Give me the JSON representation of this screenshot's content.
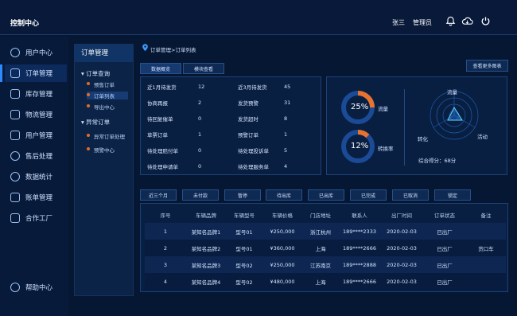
{
  "header": {
    "title": "控制中心",
    "user_name": "张三",
    "user_role": "管理员"
  },
  "sidebar": {
    "items": [
      {
        "label": "用户中心",
        "icon": "home-icon"
      },
      {
        "label": "订单管理",
        "icon": "orders-icon",
        "active": true
      },
      {
        "label": "库存管理",
        "icon": "box-icon"
      },
      {
        "label": "物流管理",
        "icon": "truck-icon"
      },
      {
        "label": "用户管理",
        "icon": "user-icon"
      },
      {
        "label": "售后处理",
        "icon": "service-icon"
      },
      {
        "label": "数据统计",
        "icon": "pie-icon"
      },
      {
        "label": "账单管理",
        "icon": "bill-icon"
      },
      {
        "label": "合作工厂",
        "icon": "factory-icon"
      }
    ],
    "help": "帮助中心"
  },
  "subnav": {
    "title": "订单管理",
    "groups": [
      {
        "label": "订单查询",
        "items": [
          "预售订单",
          "订单列表",
          "导出中心"
        ]
      },
      {
        "label": "异常订单",
        "items": [
          "异常订单处理",
          "预警中心"
        ]
      }
    ]
  },
  "breadcrumb": "订单管理>订单列表",
  "tabs": [
    "数据概览",
    "模块查看"
  ],
  "more_button": "查看更多图表",
  "stats": [
    [
      "近1月待发货",
      "12",
      "近3月待发货",
      "45"
    ],
    [
      "协商再报",
      "2",
      "发货预警",
      "31"
    ],
    [
      "待回复催单",
      "0",
      "发货超时",
      "8"
    ],
    [
      "草票订单",
      "1",
      "预警订单",
      "1"
    ],
    [
      "待处理赔付单",
      "0",
      "待处理投诉单",
      "5"
    ],
    [
      "待处理申请单",
      "0",
      "待处理服务单",
      "4"
    ]
  ],
  "donuts": [
    {
      "value": "25%",
      "label": "流量",
      "fraction": 0.25
    },
    {
      "value": "12%",
      "label": "转换率",
      "fraction": 0.12
    }
  ],
  "radar": {
    "labels": [
      "流量",
      "转化",
      "活动"
    ],
    "score": "综合得分：68分"
  },
  "filters": [
    "近三个月",
    "未付款",
    "暂停",
    "待出库",
    "已出库",
    "已完成",
    "已取消",
    "锁定"
  ],
  "table": {
    "headers": [
      "序号",
      "车辆品牌",
      "车辆型号",
      "车辆价格",
      "门店地址",
      "联系人",
      "出厂时间",
      "订单状态",
      "备注"
    ],
    "rows": [
      [
        "1",
        "某知名品牌1",
        "型号01",
        "¥250,000",
        "浙江杭州",
        "189****2333",
        "2020-02-03",
        "已出厂",
        ""
      ],
      [
        "2",
        "某知名品牌2",
        "型号01",
        "¥360,000",
        "上海",
        "189****2666",
        "2020-02-03",
        "已出厂",
        "货口车"
      ],
      [
        "3",
        "某知名品牌3",
        "型号02",
        "¥250,000",
        "江苏南京",
        "189****2888",
        "2020-02-03",
        "已出厂",
        ""
      ],
      [
        "4",
        "某知名品牌4",
        "型号02",
        "¥480,000",
        "上海",
        "189****2666",
        "2020-02-03",
        "已出厂",
        ""
      ]
    ]
  },
  "colors": {
    "accent": "#2c8cff",
    "orange": "#e8732e",
    "background": "#061733"
  }
}
